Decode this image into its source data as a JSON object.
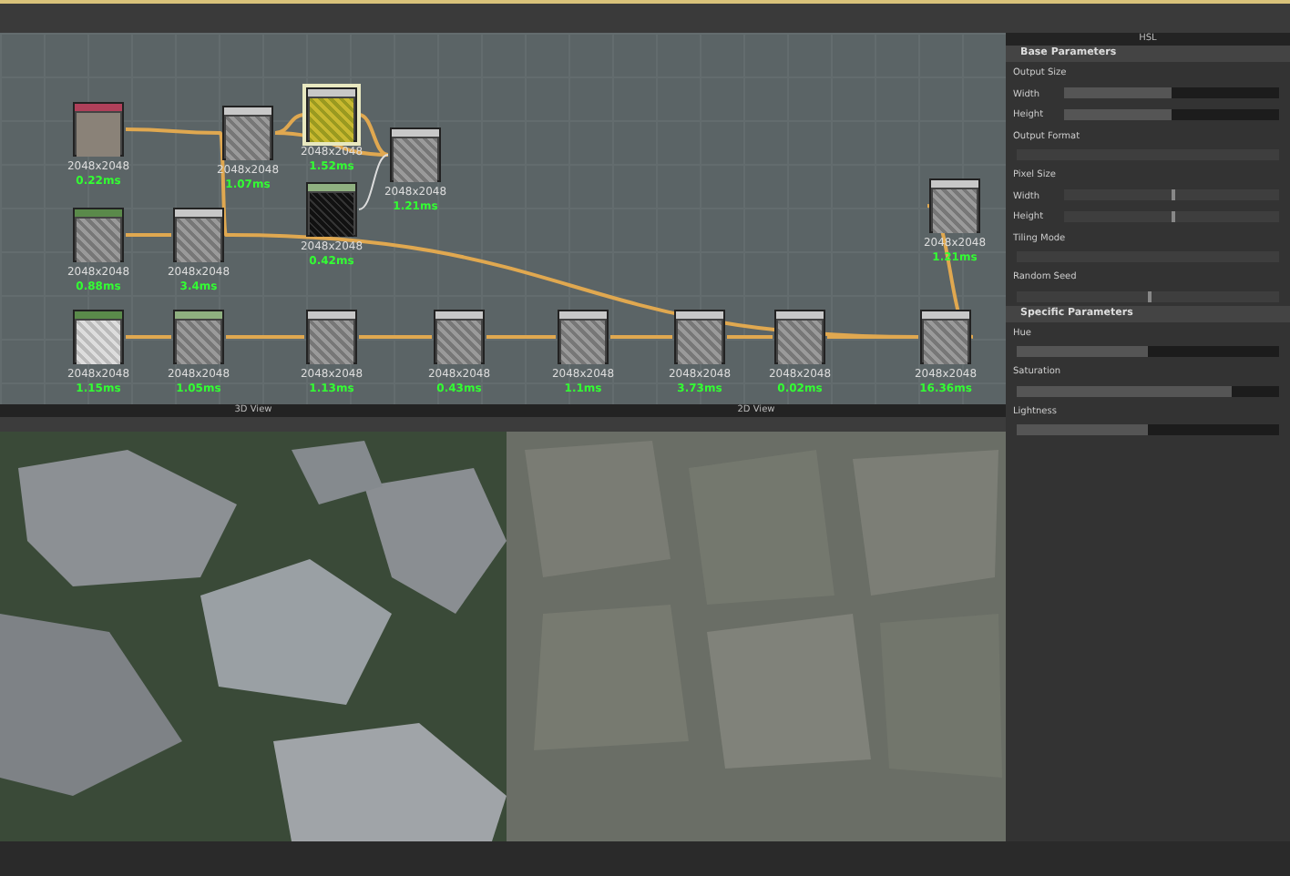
{
  "graph": {
    "nodes": [
      {
        "color": "#b0405a",
        "kind": "flat",
        "resolution": "2048x2048",
        "time": "0.22ms"
      },
      {
        "color": "#c8c8c8",
        "kind": "noise",
        "resolution": "2048x2048",
        "time": "1.07ms"
      },
      {
        "color": "#c8c8c8",
        "kind": "yellow",
        "resolution": "2048x2048",
        "time": "1.52ms",
        "selected": true
      },
      {
        "color": "#c8c8c8",
        "kind": "noise",
        "resolution": "2048x2048",
        "time": "1.21ms"
      },
      {
        "color": "#8fb080",
        "kind": "dark",
        "resolution": "2048x2048",
        "time": "0.42ms"
      },
      {
        "color": "#5a8a4a",
        "kind": "noise",
        "resolution": "2048x2048",
        "time": "0.88ms"
      },
      {
        "color": "#c8c8c8",
        "kind": "noise",
        "resolution": "2048x2048",
        "time": "3.4ms"
      },
      {
        "color": "#c8c8c8",
        "kind": "noise",
        "resolution": "2048x2048",
        "time": "1.21ms"
      },
      {
        "color": "#5a8a4a",
        "kind": "light",
        "resolution": "2048x2048",
        "time": "1.15ms"
      },
      {
        "color": "#8fb080",
        "kind": "noise",
        "resolution": "2048x2048",
        "time": "1.05ms"
      },
      {
        "color": "#c8c8c8",
        "kind": "noise",
        "resolution": "2048x2048",
        "time": "1.13ms"
      },
      {
        "color": "#c8c8c8",
        "kind": "noise",
        "resolution": "2048x2048",
        "time": "0.43ms"
      },
      {
        "color": "#c8c8c8",
        "kind": "noise",
        "resolution": "2048x2048",
        "time": "1.1ms"
      },
      {
        "color": "#c8c8c8",
        "kind": "noise",
        "resolution": "2048x2048",
        "time": "3.73ms"
      },
      {
        "color": "#c8c8c8",
        "kind": "noise",
        "resolution": "2048x2048",
        "time": "0.02ms"
      },
      {
        "color": "#c8c8c8",
        "kind": "noise",
        "resolution": "2048x2048",
        "time": "16.36ms"
      }
    ]
  },
  "view_3d": {
    "title": "3D View"
  },
  "view_2d": {
    "title": "2D View"
  },
  "properties": {
    "title": "HSL",
    "sections": [
      {
        "title": "Base Parameters",
        "params": [
          {
            "kind": "group",
            "label": "Output Size"
          },
          {
            "kind": "slider",
            "label": "Width",
            "level": 0.5
          },
          {
            "kind": "slider",
            "label": "Height",
            "level": 0.5
          },
          {
            "kind": "group",
            "label": "Output Format"
          },
          {
            "kind": "dropdown"
          },
          {
            "kind": "group",
            "label": "Pixel Size"
          },
          {
            "kind": "marker",
            "label": "Width",
            "level": 0.5
          },
          {
            "kind": "marker",
            "label": "Height",
            "level": 0.5
          },
          {
            "kind": "group",
            "label": "Tiling Mode"
          },
          {
            "kind": "dropdown"
          },
          {
            "kind": "group",
            "label": "Random Seed"
          },
          {
            "kind": "marker",
            "level": 0.5
          }
        ]
      },
      {
        "title": "Specific Parameters",
        "params": [
          {
            "kind": "group",
            "label": "Hue"
          },
          {
            "kind": "slider",
            "level": 0.5
          },
          {
            "kind": "group",
            "label": "Saturation"
          },
          {
            "kind": "slider",
            "level": 0.82
          },
          {
            "kind": "group",
            "label": "Lightness"
          },
          {
            "kind": "slider",
            "level": 0.5
          }
        ]
      }
    ]
  }
}
